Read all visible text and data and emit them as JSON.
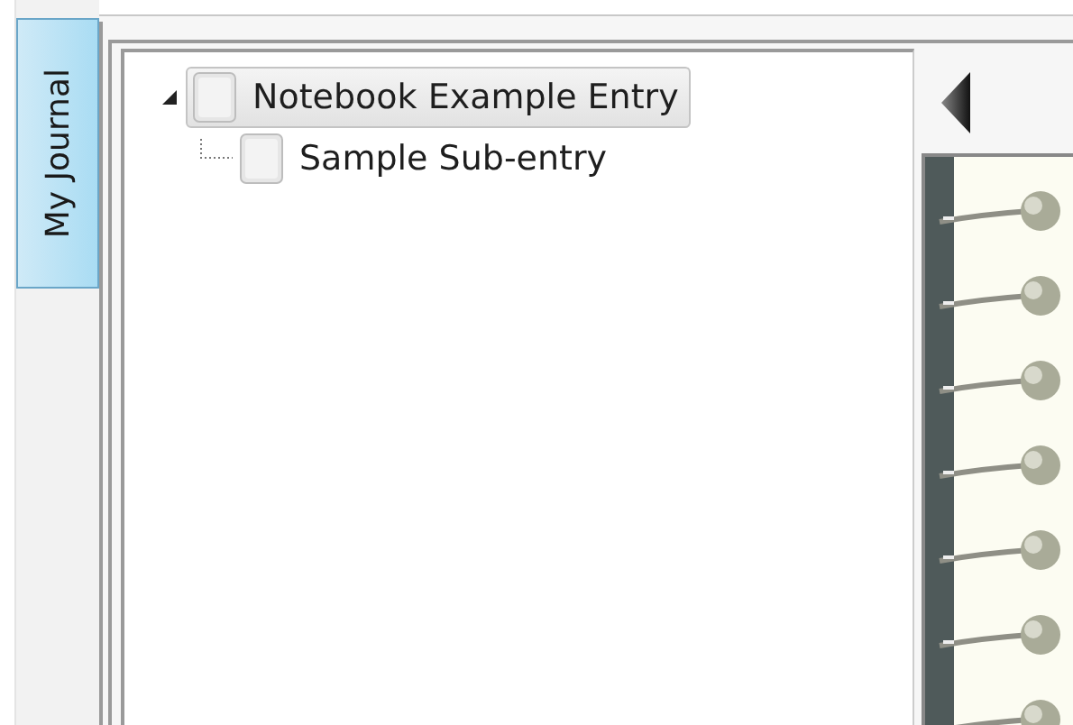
{
  "side_tab": {
    "label": "My Journal",
    "selected": true
  },
  "tree": [
    {
      "label": "Notebook Example Entry",
      "selected": true,
      "expanded": true,
      "children": [
        {
          "label": "Sample Sub-entry",
          "selected": false
        }
      ]
    }
  ]
}
